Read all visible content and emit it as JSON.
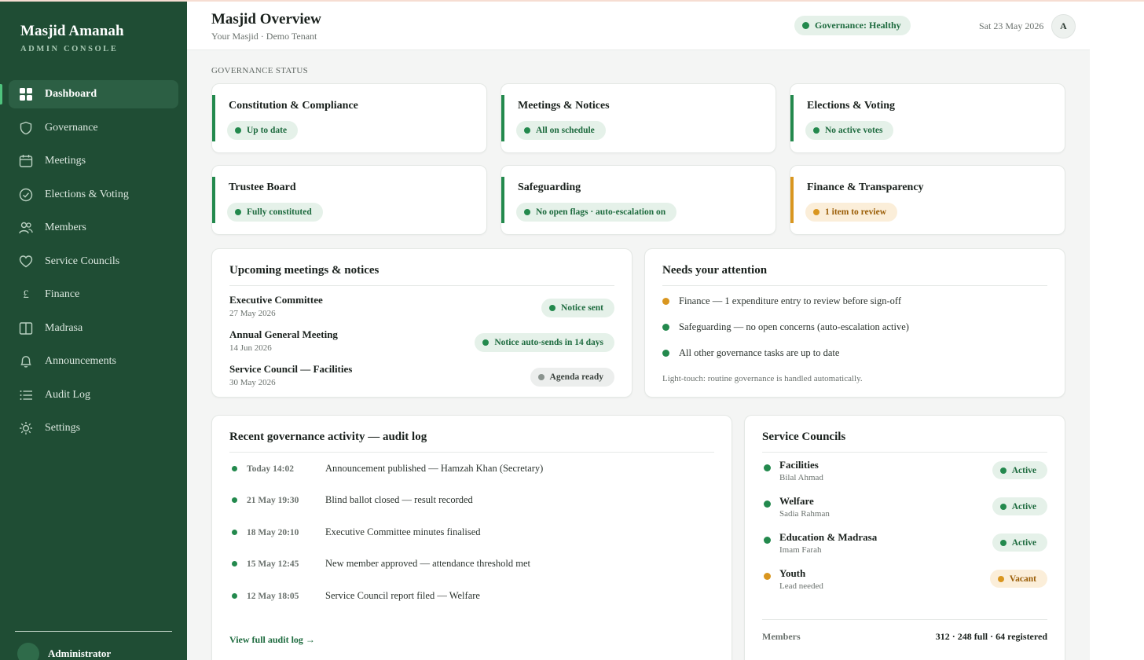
{
  "brand": {
    "name": "Masjid Amanah",
    "subtitle": "ADMIN CONSOLE"
  },
  "nav": [
    {
      "label": "Dashboard",
      "icon": "dashboard-icon",
      "active": true
    },
    {
      "label": "Governance",
      "icon": "shield-icon"
    },
    {
      "label": "Meetings",
      "icon": "calendar-icon"
    },
    {
      "label": "Elections & Voting",
      "icon": "check-circle-icon"
    },
    {
      "label": "Members",
      "icon": "members-icon"
    },
    {
      "label": "Service Councils",
      "icon": "heart-icon"
    },
    {
      "label": "Finance",
      "icon": "pound-icon"
    },
    {
      "label": "Madrasa",
      "icon": "book-icon"
    },
    {
      "label": "Announcements",
      "icon": "bell-icon"
    },
    {
      "label": "Audit Log",
      "icon": "list-icon"
    },
    {
      "label": "Settings",
      "icon": "gear-icon"
    }
  ],
  "sidebar_user": {
    "name": "Administrator"
  },
  "header": {
    "title": "Masjid Overview",
    "subtitle": "Your Masjid · Demo Tenant",
    "governance_pill": "Governance: Healthy",
    "date": "Sat 23 May 2026",
    "avatar_initial": "A"
  },
  "governance": {
    "section_label": "GOVERNANCE STATUS",
    "cards": [
      {
        "title": "Constitution & Compliance",
        "status": "Up to date",
        "tone": "ok"
      },
      {
        "title": "Meetings & Notices",
        "status": "All on schedule",
        "tone": "ok"
      },
      {
        "title": "Elections & Voting",
        "status": "No active votes",
        "tone": "ok"
      },
      {
        "title": "Trustee Board",
        "status": "Fully constituted",
        "tone": "ok"
      },
      {
        "title": "Safeguarding",
        "status": "No open flags · auto-escalation on",
        "tone": "ok"
      },
      {
        "title": "Finance & Transparency",
        "status": "1 item to review",
        "tone": "warn"
      }
    ]
  },
  "meetings": {
    "title": "Upcoming meetings & notices",
    "items": [
      {
        "name": "Executive Committee",
        "date": "27 May 2026",
        "status": "Notice sent",
        "tone": "ok"
      },
      {
        "name": "Annual General Meeting",
        "date": "14 Jun 2026",
        "status": "Notice auto-sends in 14 days",
        "tone": "ok"
      },
      {
        "name": "Service Council — Facilities",
        "date": "30 May 2026",
        "status": "Agenda ready",
        "tone": "grey"
      }
    ]
  },
  "attention": {
    "title": "Needs your attention",
    "items": [
      {
        "text": "Finance — 1 expenditure entry to review before sign-off",
        "tone": "warn"
      },
      {
        "text": "Safeguarding — no open concerns (auto-escalation active)",
        "tone": "ok"
      },
      {
        "text": "All other governance tasks are up to date",
        "tone": "ok"
      }
    ],
    "note": "Light-touch: routine governance is handled automatically."
  },
  "audit": {
    "title": "Recent governance activity — audit log",
    "items": [
      {
        "time": "Today 14:02",
        "text": "Announcement published — Hamzah Khan (Secretary)"
      },
      {
        "time": "21 May 19:30",
        "text": "Blind ballot closed — result recorded"
      },
      {
        "time": "18 May 20:10",
        "text": "Executive Committee minutes finalised"
      },
      {
        "time": "15 May 12:45",
        "text": "New member approved — attendance threshold met"
      },
      {
        "time": "12 May 18:05",
        "text": "Service Council report filed — Welfare"
      }
    ],
    "link": "View full audit log →"
  },
  "councils": {
    "title": "Service Councils",
    "items": [
      {
        "name": "Facilities",
        "lead": "Bilal Ahmad",
        "status": "Active",
        "tone": "ok"
      },
      {
        "name": "Welfare",
        "lead": "Sadia Rahman",
        "status": "Active",
        "tone": "ok"
      },
      {
        "name": "Education & Madrasa",
        "lead": "Imam Farah",
        "status": "Active",
        "tone": "ok"
      },
      {
        "name": "Youth",
        "lead": "Lead needed",
        "status": "Vacant",
        "tone": "warn"
      }
    ],
    "members_label": "Members",
    "members_value": "312 · 248 full · 64 registered"
  },
  "colors": {
    "sidebar": "#1f4d34",
    "accent_green": "#23894d",
    "warning_amber": "#d9961f"
  }
}
